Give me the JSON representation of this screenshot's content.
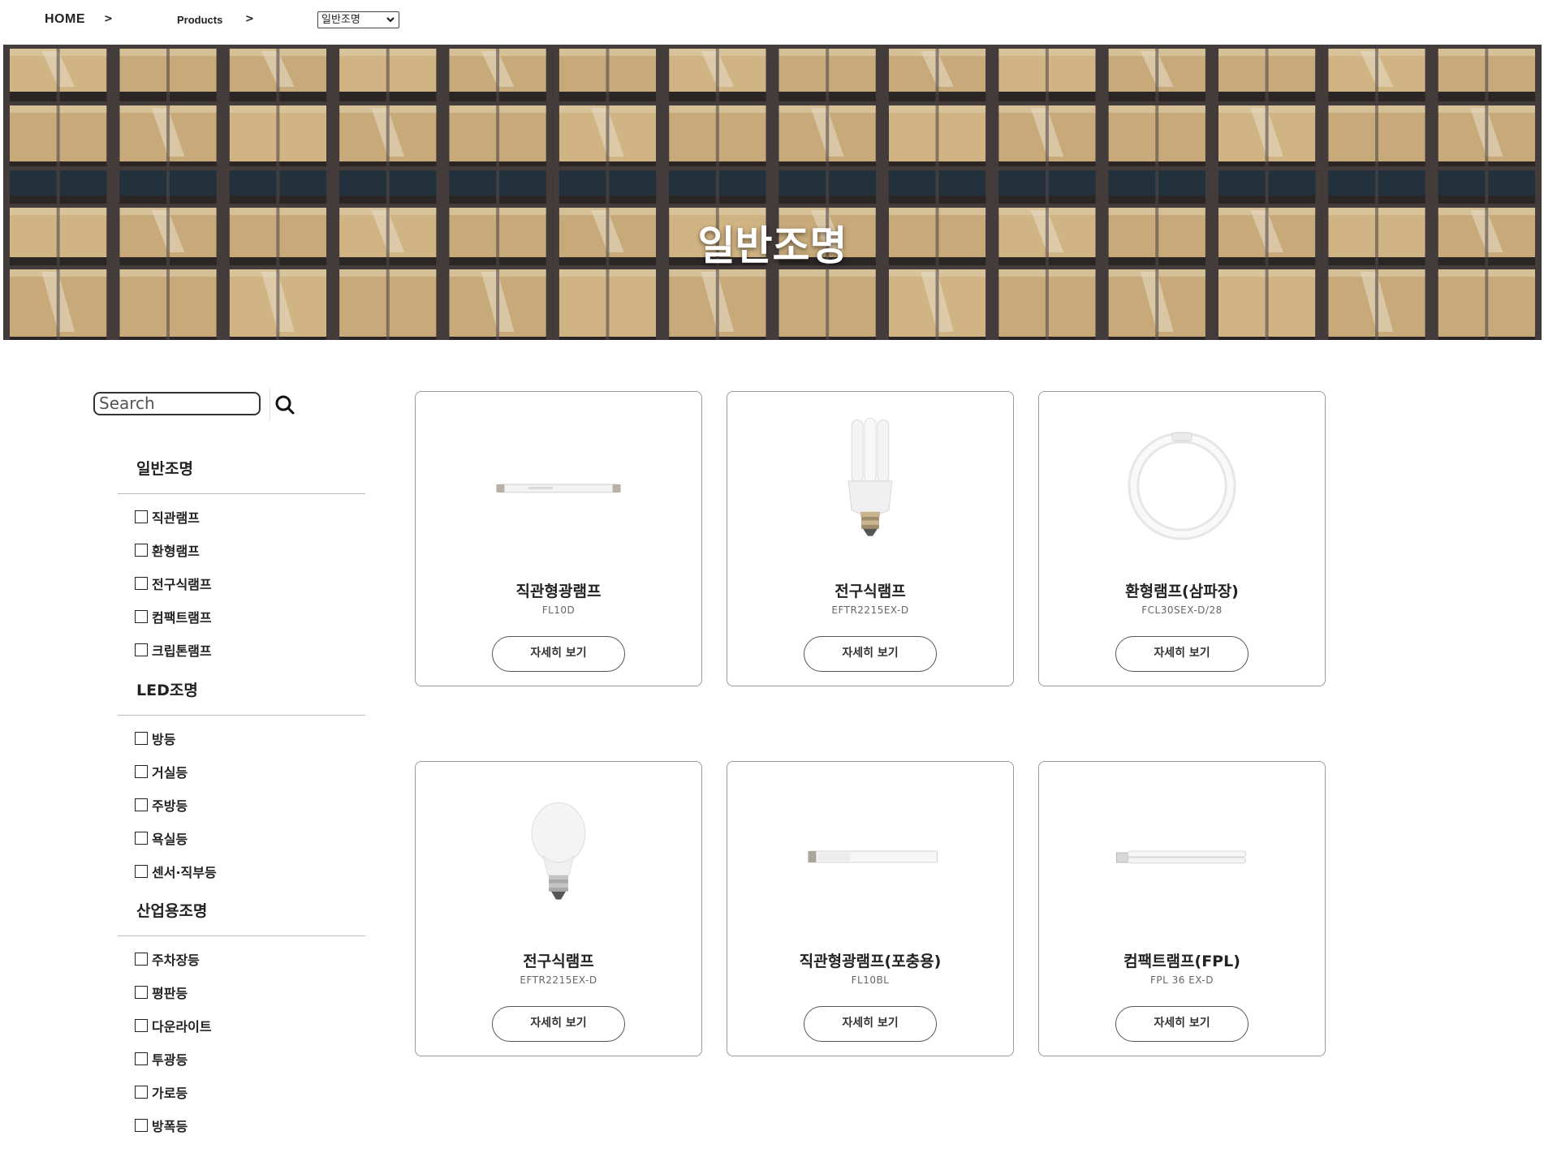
{
  "breadcrumb": {
    "home": "HOME",
    "separator": ">",
    "products": "Products",
    "select_value": "일반조명"
  },
  "hero": {
    "title": "일반조명"
  },
  "search": {
    "placeholder": "Search"
  },
  "sidebar": {
    "groups": [
      {
        "title": "일반조명",
        "items": [
          "직관램프",
          "환형램프",
          "전구식램프",
          "컴팩트램프",
          "크립톤램프"
        ]
      },
      {
        "title": "LED조명",
        "items": [
          "방등",
          "거실등",
          "주방등",
          "욕실등",
          "센서·직부등"
        ]
      },
      {
        "title": "산업용조명",
        "items": [
          "주차장등",
          "평판등",
          "다운라이트",
          "투광등",
          "가로등",
          "방폭등"
        ]
      }
    ]
  },
  "products": [
    {
      "name": "직관형광램프",
      "code": "FL10D",
      "button": "자세히 보기",
      "icon": "tube-lamp-icon"
    },
    {
      "name": "전구식램프",
      "code": "EFTR2215EX-D",
      "button": "자세히 보기",
      "icon": "compact-bulb-icon"
    },
    {
      "name": "환형램프(삼파장)",
      "code": "FCL30SEX-D/28",
      "button": "자세히 보기",
      "icon": "circular-lamp-icon"
    },
    {
      "name": "전구식램프",
      "code": "EFTR2215EX-D",
      "button": "자세히 보기",
      "icon": "incandescent-bulb-icon"
    },
    {
      "name": "직관형광램프(포충용)",
      "code": "FL10BL",
      "button": "자세히 보기",
      "icon": "tube-lamp-icon"
    },
    {
      "name": "컴팩트램프(FPL)",
      "code": "FPL 36 EX-D",
      "button": "자세히 보기",
      "icon": "fpl-lamp-icon"
    }
  ],
  "colors": {
    "card_border": "#999999",
    "text": "#222222",
    "hero_warm": "#d9b985",
    "hero_frame": "#4a4140"
  }
}
